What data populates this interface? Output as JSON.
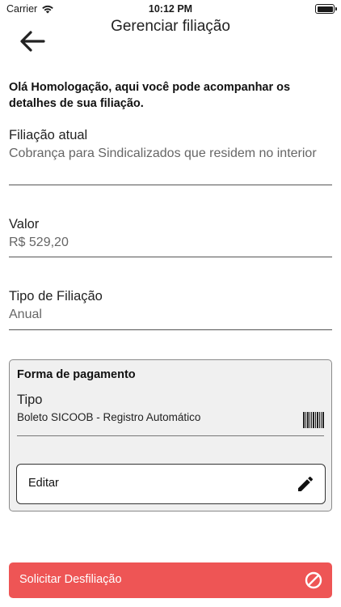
{
  "status_bar": {
    "carrier": "Carrier",
    "time": "10:12 PM",
    "icons": [
      "wifi-icon",
      "battery-icon"
    ]
  },
  "header": {
    "title": "Gerenciar filiação",
    "back_icon": "arrow-left-icon"
  },
  "intro_text": "Olá Homologação, aqui você pode acompanhar os detalhes de sua filiação.",
  "fields": [
    {
      "label": "Filiação atual",
      "value": "Cobrança para Sindicalizados que residem no interior"
    },
    {
      "label": "Valor",
      "value": "R$ 529,20"
    },
    {
      "label": "Tipo de Filiação",
      "value": "Anual"
    }
  ],
  "payment": {
    "title": "Forma de pagamento",
    "type_label": "Tipo",
    "type_value": "Boleto SICOOB - Registro Automático",
    "type_icon": "barcode-icon",
    "edit_label": "Editar",
    "edit_icon": "pencil-icon"
  },
  "unsubscribe": {
    "label": "Solicitar Desfiliação",
    "icon": "block-icon",
    "color": "#ee5555"
  }
}
